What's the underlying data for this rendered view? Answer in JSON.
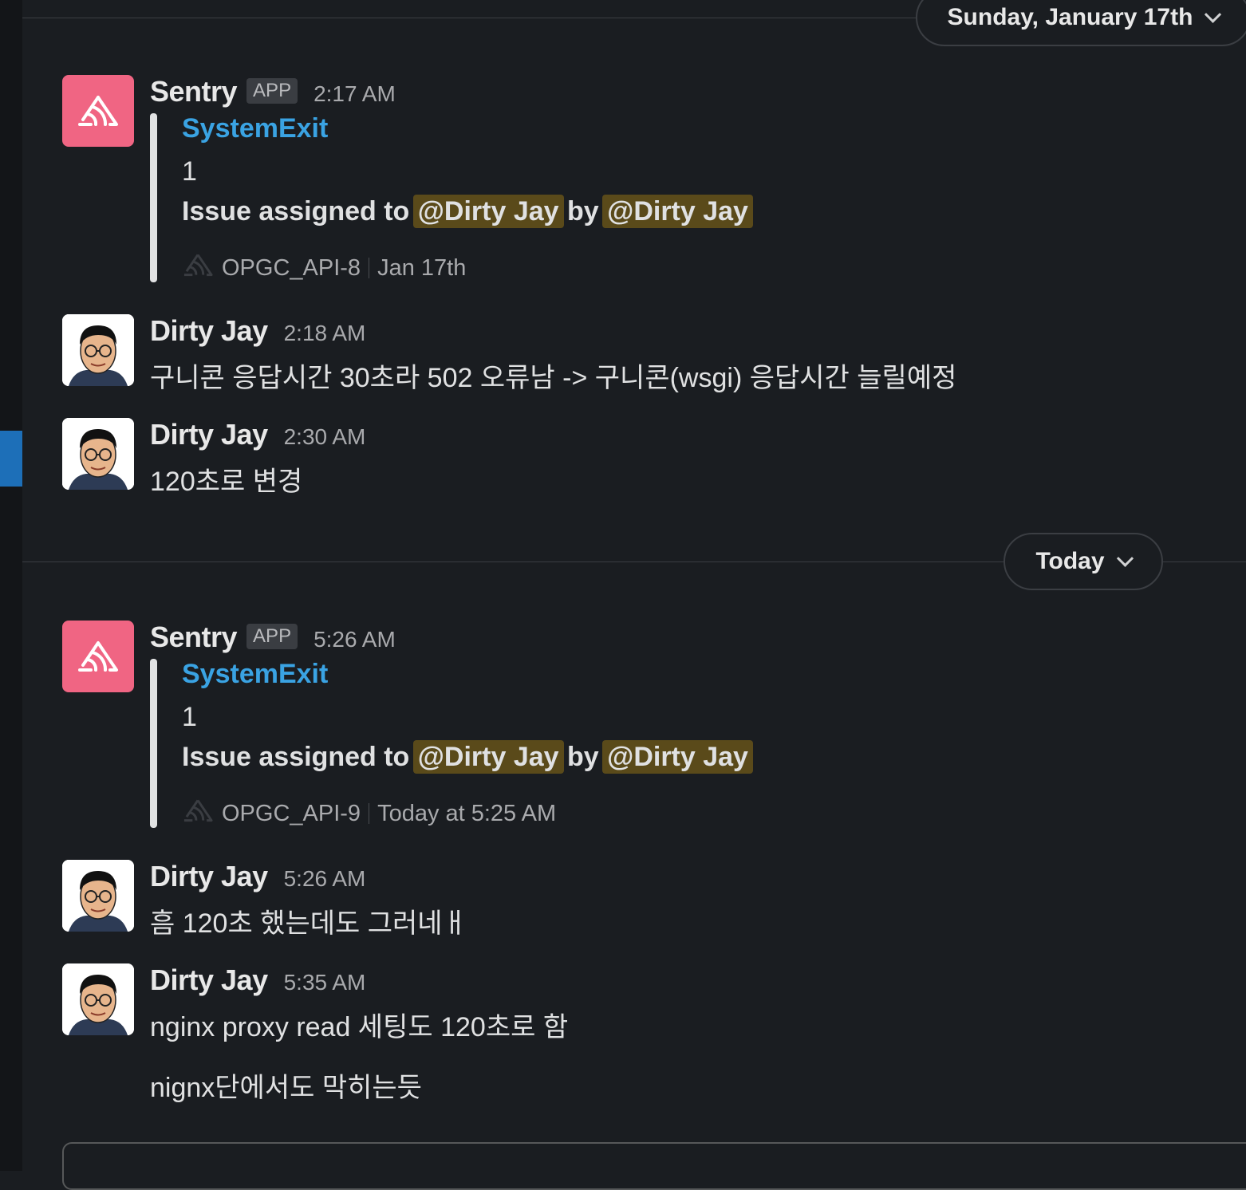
{
  "dates": {
    "sunday": "Sunday, January 17th",
    "today": "Today"
  },
  "messages": [
    {
      "author": "Sentry",
      "badge": "APP",
      "time": "2:17 AM",
      "attachment": {
        "title": "SystemExit",
        "value": "1",
        "issue_prefix": "Issue assigned to",
        "mention1": "@Dirty Jay",
        "by": "by",
        "mention2": "@Dirty Jay",
        "footer_id": "OPGC_API-8",
        "footer_time": "Jan 17th"
      }
    },
    {
      "author": "Dirty Jay",
      "time": "2:18 AM",
      "text": "구니콘 응답시간 30초라 502 오류남 -> 구니콘(wsgi) 응답시간 늘릴예정"
    },
    {
      "author": "Dirty Jay",
      "time": "2:30 AM",
      "text": "120초로 변경"
    },
    {
      "author": "Sentry",
      "badge": "APP",
      "time": "5:26 AM",
      "attachment": {
        "title": "SystemExit",
        "value": "1",
        "issue_prefix": "Issue assigned to",
        "mention1": "@Dirty Jay",
        "by": "by",
        "mention2": "@Dirty Jay",
        "footer_id": "OPGC_API-9",
        "footer_time": "Today at 5:25 AM"
      }
    },
    {
      "author": "Dirty Jay",
      "time": "5:26 AM",
      "text": "흠 120초 했는데도 그러네ㅐ"
    },
    {
      "author": "Dirty Jay",
      "time": "5:35 AM",
      "text": "nginx proxy read 세팅도 120초로 함",
      "text2": "nignx단에서도 막히는듯"
    }
  ],
  "icons": {
    "sentry_logo": "sentry-logo-icon",
    "chevron": "chevron-down-icon",
    "avatar": "person-avatar"
  },
  "colors": {
    "background": "#1a1d21",
    "link": "#3aa3e3",
    "mention_bg": "#5a4a1a",
    "mention_fg": "#f2c744",
    "sentry": "#f06583"
  }
}
